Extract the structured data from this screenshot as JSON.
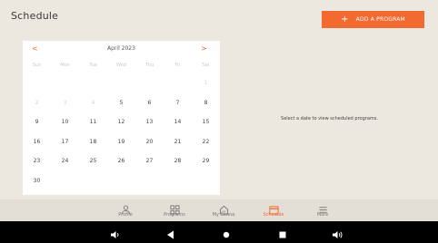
{
  "page": {
    "title": "Schedule"
  },
  "actions": {
    "add_program": "ADD A PROGRAM"
  },
  "calendar": {
    "prev_glyph": "<",
    "next_glyph": ">",
    "month_label": "April 2023",
    "weekdays": [
      "Sun",
      "Mon",
      "Tue",
      "Wed",
      "Thu",
      "Fri",
      "Sat"
    ],
    "weeks": [
      [
        {
          "d": "",
          "m": true
        },
        {
          "d": "",
          "m": true
        },
        {
          "d": "",
          "m": true
        },
        {
          "d": "",
          "m": true
        },
        {
          "d": "",
          "m": true
        },
        {
          "d": "",
          "m": true
        },
        {
          "d": "1",
          "m": true
        }
      ],
      [
        {
          "d": "2",
          "m": true
        },
        {
          "d": "3",
          "m": true
        },
        {
          "d": "4",
          "m": true
        },
        {
          "d": "5",
          "m": false
        },
        {
          "d": "6",
          "m": false
        },
        {
          "d": "7",
          "m": false
        },
        {
          "d": "8",
          "m": false
        }
      ],
      [
        {
          "d": "9",
          "m": false
        },
        {
          "d": "10",
          "m": false
        },
        {
          "d": "11",
          "m": false
        },
        {
          "d": "12",
          "m": false
        },
        {
          "d": "13",
          "m": false
        },
        {
          "d": "14",
          "m": false
        },
        {
          "d": "15",
          "m": false
        }
      ],
      [
        {
          "d": "16",
          "m": false
        },
        {
          "d": "17",
          "m": false
        },
        {
          "d": "18",
          "m": false
        },
        {
          "d": "19",
          "m": false
        },
        {
          "d": "20",
          "m": false
        },
        {
          "d": "21",
          "m": false
        },
        {
          "d": "22",
          "m": false
        }
      ],
      [
        {
          "d": "23",
          "m": false
        },
        {
          "d": "24",
          "m": false
        },
        {
          "d": "25",
          "m": false
        },
        {
          "d": "26",
          "m": false
        },
        {
          "d": "27",
          "m": false
        },
        {
          "d": "28",
          "m": false
        },
        {
          "d": "29",
          "m": false
        }
      ],
      [
        {
          "d": "30",
          "m": false
        },
        {
          "d": "",
          "m": true
        },
        {
          "d": "",
          "m": true
        },
        {
          "d": "",
          "m": true
        },
        {
          "d": "",
          "m": true
        },
        {
          "d": "",
          "m": true
        },
        {
          "d": "",
          "m": true
        }
      ]
    ]
  },
  "schedule": {
    "empty_hint": "Select a date to view scheduled programs."
  },
  "bottom_nav": {
    "tabs": [
      {
        "id": "profile",
        "label": "Profile",
        "icon": "person-icon",
        "active": false
      },
      {
        "id": "programs",
        "label": "Programs",
        "icon": "grid-icon",
        "active": false
      },
      {
        "id": "my-sauna",
        "label": "My Sauna",
        "icon": "sauna-icon",
        "active": false
      },
      {
        "id": "schedule",
        "label": "Schedule",
        "icon": "calendar-icon",
        "active": true
      },
      {
        "id": "more",
        "label": "More",
        "icon": "menu-icon",
        "active": false
      }
    ]
  },
  "system_bar": [
    "volume-down-icon",
    "back-icon",
    "home-icon",
    "recents-icon",
    "volume-up-icon"
  ],
  "colors": {
    "accent": "#f26a30",
    "background": "#ece7df",
    "card": "#ffffff",
    "nav_bar": "#e3dfd6"
  }
}
